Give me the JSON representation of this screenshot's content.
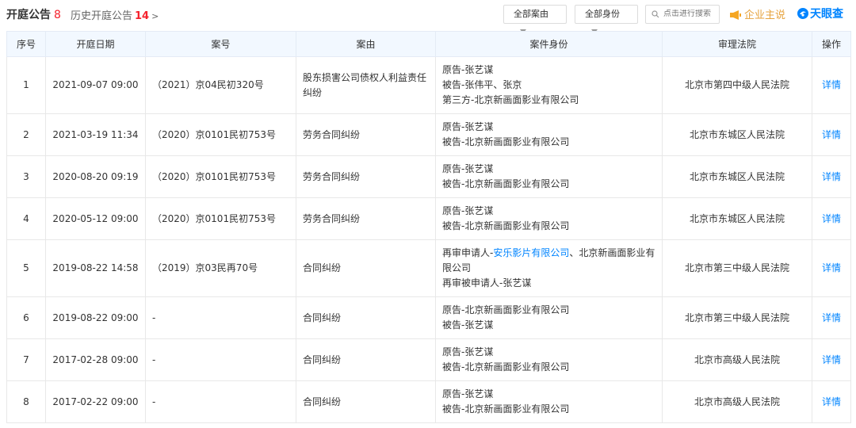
{
  "header": {
    "title": "开庭公告",
    "title_count": "8",
    "history_label": "历史开庭公告",
    "history_count": "14",
    "filter_cause": "全部案由",
    "filter_identity": "全部身份",
    "search_placeholder": "点击进行搜索",
    "sponsor_label": "企业主说",
    "brand": "天眼查"
  },
  "table": {
    "columns": [
      "序号",
      "开庭日期",
      "案号",
      "案由",
      "案件身份",
      "审理法院",
      "操作"
    ],
    "rows": [
      {
        "no": "1",
        "date": "2021-09-07 09:00",
        "case_no": "（2021）京04民初320号",
        "cause": "股东损害公司债权人利益责任纠纷",
        "parties": [
          "原告-张艺谋",
          "被告-张伟平、张京",
          "第三方-北京新画面影业有限公司"
        ],
        "court": "北京市第四中级人民法院",
        "action": "详情"
      },
      {
        "no": "2",
        "date": "2021-03-19 11:34",
        "case_no": "（2020）京0101民初753号",
        "cause": "劳务合同纠纷",
        "parties": [
          "原告-张艺谋",
          "被告-北京新画面影业有限公司"
        ],
        "court": "北京市东城区人民法院",
        "action": "详情"
      },
      {
        "no": "3",
        "date": "2020-08-20 09:19",
        "case_no": "（2020）京0101民初753号",
        "cause": "劳务合同纠纷",
        "parties": [
          "原告-张艺谋",
          "被告-北京新画面影业有限公司"
        ],
        "court": "北京市东城区人民法院",
        "action": "详情"
      },
      {
        "no": "4",
        "date": "2020-05-12 09:00",
        "case_no": "（2020）京0101民初753号",
        "cause": "劳务合同纠纷",
        "parties": [
          "原告-张艺谋",
          "被告-北京新画面影业有限公司"
        ],
        "court": "北京市东城区人民法院",
        "action": "详情"
      },
      {
        "no": "5",
        "date": "2019-08-22 14:58",
        "case_no": "（2019）京03民再70号",
        "cause": "合同纠纷",
        "parties_rich": {
          "prefix": "再审申请人-",
          "link": "安乐影片有限公司",
          "suffix": "、北京新画面影业有限公司",
          "line2": "再审被申请人-张艺谋"
        },
        "court": "北京市第三中级人民法院",
        "action": "详情"
      },
      {
        "no": "6",
        "date": "2019-08-22 09:00",
        "case_no": "-",
        "cause": "合同纠纷",
        "parties": [
          "原告-北京新画面影业有限公司",
          "被告-张艺谋"
        ],
        "court": "北京市第三中级人民法院",
        "action": "详情"
      },
      {
        "no": "7",
        "date": "2017-02-28 09:00",
        "case_no": "-",
        "cause": "合同纠纷",
        "parties": [
          "原告-张艺谋",
          "被告-北京新画面影业有限公司"
        ],
        "court": "北京市高级人民法院",
        "action": "详情"
      },
      {
        "no": "8",
        "date": "2017-02-22 09:00",
        "case_no": "-",
        "cause": "合同纠纷",
        "parties": [
          "原告-张艺谋",
          "被告-北京新画面影业有限公司"
        ],
        "court": "北京市高级人民法院",
        "action": "详情"
      }
    ]
  },
  "colors": {
    "accent": "#0084ff",
    "count": "#f5222d",
    "sponsor": "#e6a23c",
    "header_bg": "#f2f8ff"
  },
  "icons": {
    "search": "search-icon",
    "sponsor": "megaphone-icon",
    "brand": "brand-logo-icon",
    "history": "chevron-right-icon"
  }
}
